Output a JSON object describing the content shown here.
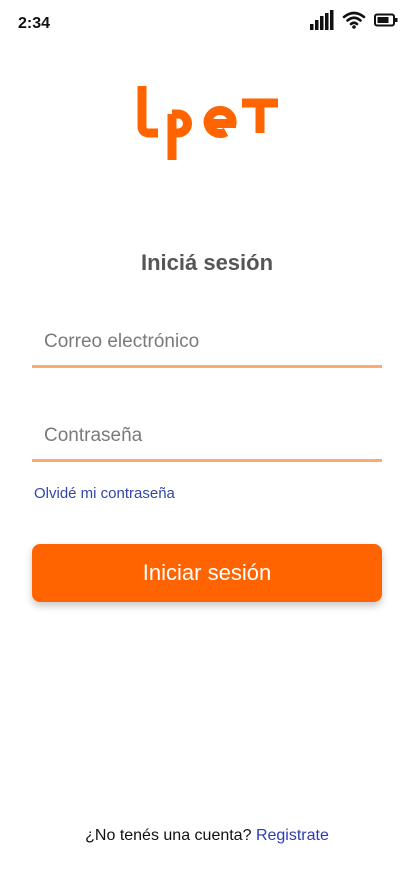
{
  "status_bar": {
    "time": "2:34",
    "icons": [
      "signal-icon",
      "wifi-icon",
      "battery-icon"
    ]
  },
  "brand": {
    "logo_text": "lpet",
    "color": "#ff6400"
  },
  "login": {
    "title": "Iniciá sesión",
    "email_placeholder": "Correo electrónico",
    "password_placeholder": "Contraseña",
    "forgot_label": "Olvidé mi contraseña",
    "submit_label": "Iniciar sesión"
  },
  "signup": {
    "prompt": "¿No tenés una cuenta?",
    "link_label": "Registrate"
  },
  "colors": {
    "accent": "#ff6400",
    "underline": "#ffa86f",
    "link": "#3346a8"
  }
}
